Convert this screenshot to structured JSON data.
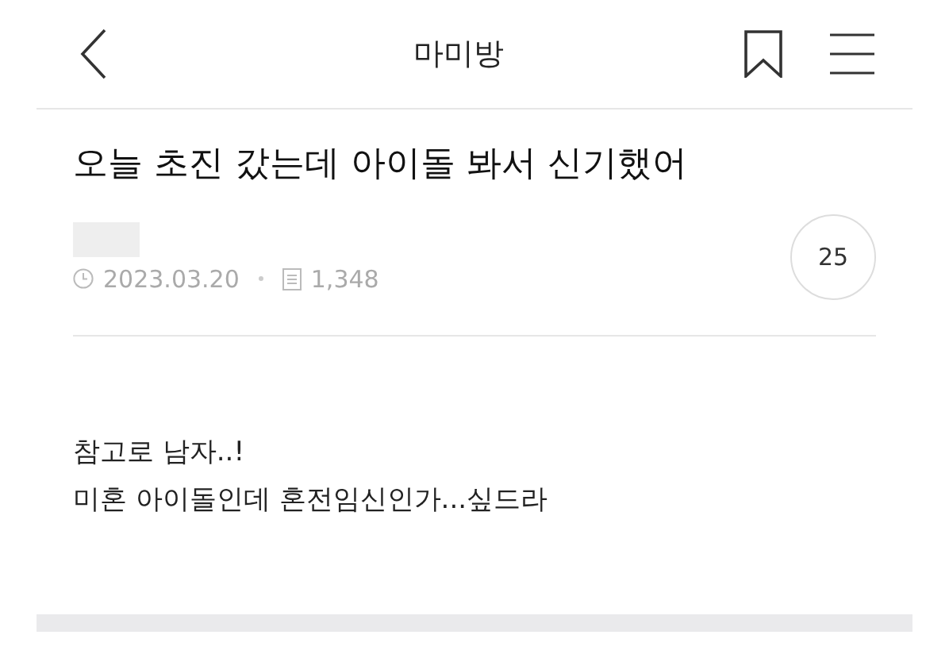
{
  "header": {
    "title": "마미방"
  },
  "post": {
    "title": "오늘 초진 갔는데 아이돌 봐서 신기했어",
    "date": "2023.03.20",
    "views": "1,348",
    "comments": "25",
    "body": [
      "참고로 남자..!",
      "미혼 아이돌인데 혼전임신인가...싶드라"
    ]
  }
}
